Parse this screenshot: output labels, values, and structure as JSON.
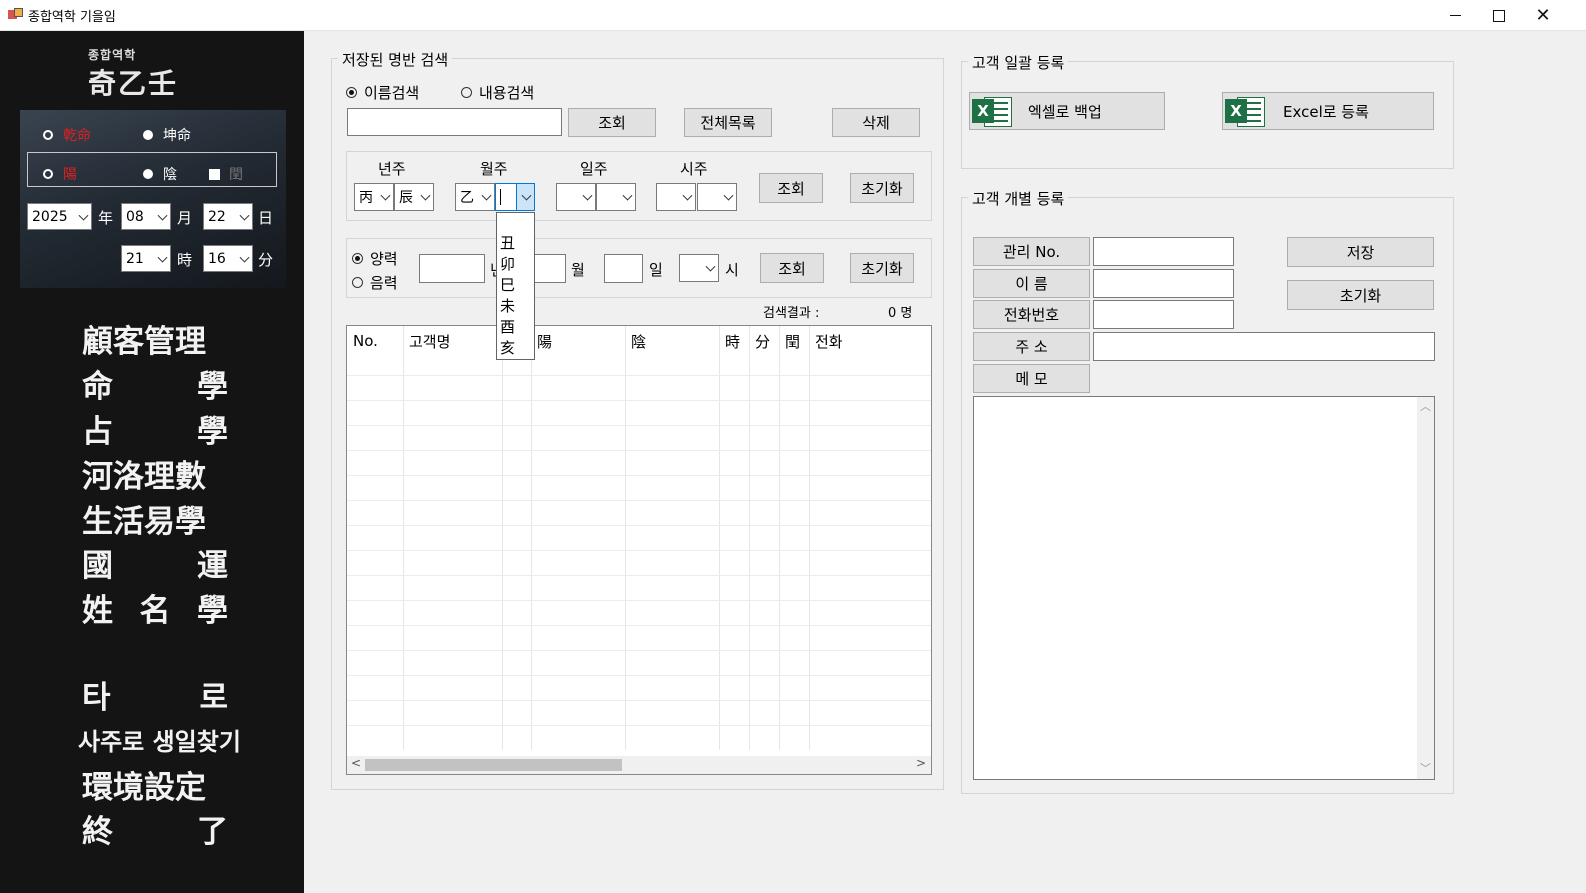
{
  "window": {
    "title": "종합역학 기을임"
  },
  "sidebar": {
    "logo_small": "종합역학",
    "logo_big": "奇乙壬",
    "gender": {
      "male": "乾命",
      "female": "坤命"
    },
    "calendar": {
      "yang": "陽",
      "eum": "陰",
      "leap": "閏"
    },
    "date": {
      "year": "2025",
      "year_unit": "年",
      "month": "08",
      "month_unit": "月",
      "day": "22",
      "day_unit": "日",
      "hour": "21",
      "hour_unit": "時",
      "minute": "16",
      "minute_unit": "分"
    },
    "menu": [
      "顧客管理",
      "命 學",
      "占 學",
      "河洛理數",
      "生活易學",
      "國 運",
      "姓 名 學",
      "타 로",
      "사주로 생일찾기",
      "環境設定",
      "終 了"
    ]
  },
  "search": {
    "group_title": "저장된 명반 검색",
    "radio_name": "이름검색",
    "radio_content": "내용검색",
    "search_value": "",
    "btn_query": "조회",
    "btn_all": "전체목록",
    "btn_delete": "삭제",
    "pillars": {
      "year_label": "년주",
      "month_label": "월주",
      "day_label": "일주",
      "hour_label": "시주",
      "year_stem": "丙",
      "year_branch": "辰",
      "month_stem": "乙",
      "month_branch": "",
      "btn_query": "조회",
      "btn_reset": "초기화"
    },
    "dropdown_options": [
      "丑",
      "卯",
      "巳",
      "未",
      "酉",
      "亥"
    ],
    "date_search": {
      "solar": "양력",
      "lunar": "음력",
      "year_unit": "년",
      "month_unit": "월",
      "day_unit": "일",
      "hour_unit": "시",
      "btn_query": "조회",
      "btn_reset": "초기화"
    },
    "result_label": "검색결과 :",
    "result_count": "0 명",
    "columns": [
      "No.",
      "고객명",
      "陽",
      "陰",
      "時",
      "分",
      "閏",
      "전화"
    ]
  },
  "bulk": {
    "group_title": "고객 일괄 등록",
    "btn_backup": "엑셀로 백업",
    "btn_import": "Excel로 등록"
  },
  "single": {
    "group_title": "고객 개별 등록",
    "labels": {
      "no": "관리 No.",
      "name": "이 름",
      "phone": "전화번호",
      "address": "주 소",
      "memo": "메 모"
    },
    "btn_save": "저장",
    "btn_reset": "초기화"
  },
  "colors": {
    "sidebar_bg": "#141414",
    "accent_red": "#e02020",
    "excel_green": "#1e7145"
  }
}
